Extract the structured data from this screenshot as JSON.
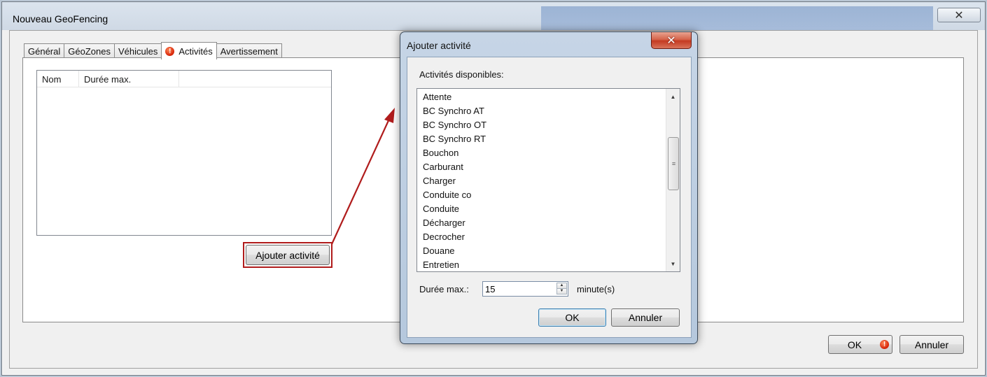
{
  "main_window": {
    "title": "Nouveau GeoFencing",
    "close_glyph": "✕",
    "tabs": [
      {
        "label": "Général"
      },
      {
        "label": "GéoZones"
      },
      {
        "label": "Véhicules"
      },
      {
        "label": "Activités",
        "has_warning": true
      },
      {
        "label": "Avertissement"
      }
    ],
    "active_tab": "Activités",
    "list_columns": [
      "Nom",
      "Durée max."
    ],
    "add_activity_label": "Ajouter activité",
    "ok_label": "OK",
    "cancel_label": "Annuler",
    "warning_glyph": "!"
  },
  "dialog": {
    "title": "Ajouter activité",
    "close_glyph": "✕",
    "available_label": "Activités disponibles:",
    "activities": [
      "Attente",
      "BC Synchro AT",
      "BC Synchro OT",
      "BC Synchro RT",
      "Bouchon",
      "Carburant",
      "Charger",
      "Conduite co",
      "Conduite",
      "Décharger",
      "Decrocher",
      "Douane",
      "Entretien"
    ],
    "duration_label": "Durée max.:",
    "duration_value": "15",
    "duration_unit": "minute(s)",
    "ok_label": "OK",
    "cancel_label": "Annuler"
  },
  "colors": {
    "highlight": "#b01c1c",
    "warning": "#d9280b",
    "dialog_frame": "#b5c8dd",
    "close_button": "#c43a22"
  },
  "icons": {
    "warning": "warning-icon",
    "scroll_up": "scroll-up-icon",
    "scroll_down": "scroll-down-icon",
    "spin_up": "spin-up-icon",
    "spin_down": "spin-down-icon"
  }
}
